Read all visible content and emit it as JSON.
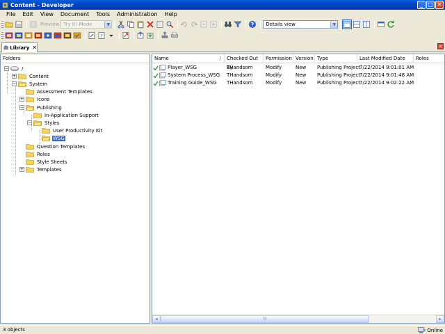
{
  "window": {
    "title": "Content - Developer",
    "controls": {
      "minimize": "_",
      "maximize": "□",
      "close": "✕"
    }
  },
  "menu": [
    "File",
    "Edit",
    "View",
    "Document",
    "Tools",
    "Administration",
    "Help"
  ],
  "toolbar1": {
    "preview_label": "Preview",
    "mode_select": "Try It! Mode",
    "view_select": "Details view"
  },
  "tab": {
    "label": "Library",
    "close": "✕"
  },
  "folders": {
    "header": "Folders",
    "items": [
      {
        "label": "/",
        "icon": "disk-icon",
        "expander": "−"
      },
      {
        "label": "Content",
        "icon": "folder-icon",
        "expander": "+"
      },
      {
        "label": "System",
        "icon": "folder-icon",
        "expander": "−"
      },
      {
        "label": "Assessment Templates",
        "icon": "folder-icon",
        "expander": ""
      },
      {
        "label": "Icons",
        "icon": "folder-icon",
        "expander": "+"
      },
      {
        "label": "Publishing",
        "icon": "folder-icon",
        "expander": "−"
      },
      {
        "label": "In-Application Support",
        "icon": "folder-icon",
        "expander": ""
      },
      {
        "label": "Styles",
        "icon": "folder-icon",
        "expander": "−"
      },
      {
        "label": "User Productivity Kit",
        "icon": "folder-icon",
        "expander": ""
      },
      {
        "label": "WSG",
        "icon": "folder-icon",
        "expander": "",
        "selected": true
      },
      {
        "label": "Question Templates",
        "icon": "folder-icon",
        "expander": ""
      },
      {
        "label": "Roles",
        "icon": "folder-icon",
        "expander": ""
      },
      {
        "label": "Style Sheets",
        "icon": "folder-icon",
        "expander": ""
      },
      {
        "label": "Templates",
        "icon": "folder-icon",
        "expander": "+"
      }
    ]
  },
  "details": {
    "columns": [
      "Name",
      "Checked Out By",
      "Permission",
      "Version",
      "Type",
      "Last Modified Date",
      "Roles"
    ],
    "sort_indicator": "/",
    "rows": [
      {
        "name": "Player_WSG",
        "checked_out_by": "THandsom",
        "permission": "Modify",
        "version": "New",
        "type": "Publishing Project",
        "modified": "7/22/2014 9:01:01 AM",
        "roles": ""
      },
      {
        "name": "System Process_WSG",
        "checked_out_by": "THandsom",
        "permission": "Modify",
        "version": "New",
        "type": "Publishing Project",
        "modified": "7/22/2014 9:01:48 AM",
        "roles": ""
      },
      {
        "name": "Training Guide_WSG",
        "checked_out_by": "THandsom",
        "permission": "Modify",
        "version": "New",
        "type": "Publishing Project",
        "modified": "7/22/2014 9:02:22 AM",
        "roles": ""
      }
    ],
    "scrollbar": {
      "thumb_grip": "III",
      "left_arrow": "◂",
      "right_arrow": "▸"
    }
  },
  "status": {
    "object_count": "3 objects",
    "connection": "Online"
  },
  "colors": {
    "titlebar": "#0046c8",
    "selection": "#316ac5",
    "folder": "#f5d35a",
    "check": "#2a9a2a"
  }
}
